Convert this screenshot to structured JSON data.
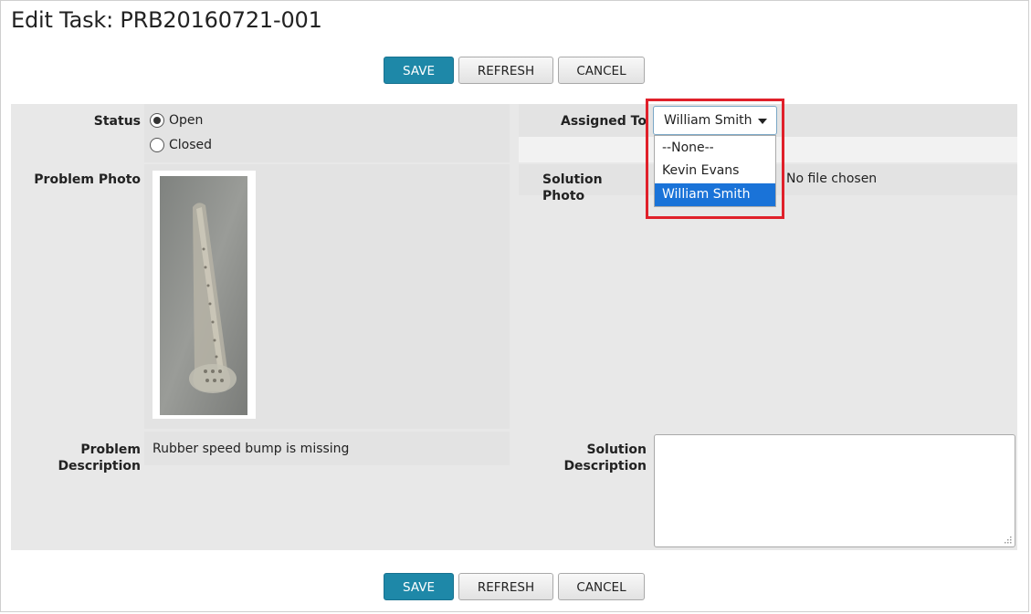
{
  "page": {
    "title": "Edit Task: PRB20160721-001"
  },
  "toolbar": {
    "save_label": "SAVE",
    "refresh_label": "REFRESH",
    "cancel_label": "CANCEL"
  },
  "form": {
    "status_label": "Status",
    "status_options": [
      {
        "label": "Open",
        "checked": true
      },
      {
        "label": "Closed",
        "checked": false
      }
    ],
    "problem_photo_label": "Problem Photo",
    "problem_description_label_1": "Problem",
    "problem_description_label_2": "Description",
    "problem_description_value": "Rubber speed bump is missing",
    "assigned_to_label": "Assigned To",
    "assigned_to_value": "William Smith",
    "assigned_to_options": [
      "--None--",
      "Kevin Evans",
      "William Smith"
    ],
    "solution_photo_label": "Solution Photo",
    "solution_photo_status": "No file chosen",
    "solution_description_label_1": "Solution",
    "solution_description_label_2": "Description",
    "solution_description_value": ""
  },
  "colors": {
    "primary": "#1e88a8",
    "highlight": "#e0202a",
    "selected_option": "#1a73d8"
  }
}
